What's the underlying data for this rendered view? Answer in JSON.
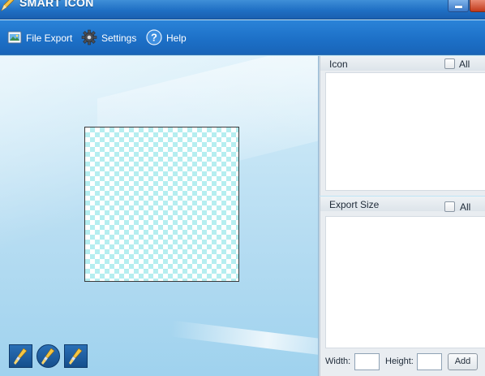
{
  "window": {
    "title": "SMART ICON",
    "title_icon": "pencil-icon",
    "controls": [
      "minimize-icon",
      "close-icon"
    ]
  },
  "toolbar": {
    "items": [
      {
        "label": "File Export",
        "icon": "file-export-icon"
      },
      {
        "label": "Settings",
        "icon": "gear-icon"
      },
      {
        "label": "Help",
        "icon": "help-icon"
      }
    ]
  },
  "canvas": {
    "tools": [
      {
        "icon": "brush-icon"
      },
      {
        "icon": "brush-round-icon"
      },
      {
        "icon": "brush-icon"
      }
    ]
  },
  "icon_panel": {
    "title": "Icon",
    "all_label": "All",
    "all_checked": false
  },
  "export_panel": {
    "title": "Export Size",
    "all_label": "All",
    "all_checked": false,
    "width_label": "Width:",
    "height_label": "Height:",
    "width_value": "",
    "height_value": "",
    "add_label": "Add"
  },
  "colors": {
    "titlebar": "#1f6fc4",
    "toolbar": "#1c6fc6",
    "checker": "#b5eef0",
    "panel": "#e9edf1"
  }
}
